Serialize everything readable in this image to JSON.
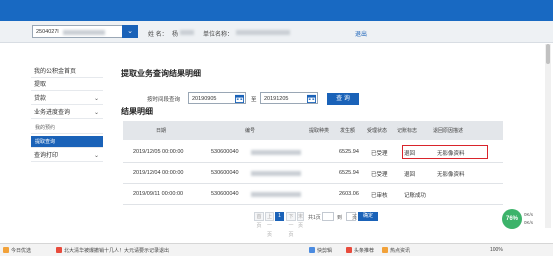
{
  "header": {
    "account_value": "2504027l",
    "name_label": "姓 名：",
    "name_value": "杨",
    "unit_label": "单位名称：",
    "exit_link": "退出"
  },
  "sidebar": {
    "items": [
      {
        "label": "我的公积金首页",
        "chevron": ""
      },
      {
        "label": "提取",
        "chevron": ""
      },
      {
        "label": "贷款",
        "chevron": "⌄"
      },
      {
        "label": "业务进度查询",
        "chevron": "⌄"
      },
      {
        "label": "我的预约",
        "chevron": ""
      },
      {
        "label": "提取查询",
        "chevron": ""
      },
      {
        "label": "查询打印",
        "chevron": "⌄"
      }
    ]
  },
  "main": {
    "page_title": "提取业务查询结果明细",
    "filter_label": "按时间段查询",
    "date_from": "20190905",
    "to_label": "至",
    "date_to": "20191205",
    "query_button": "查 询",
    "section_title": "结果明细"
  },
  "table": {
    "columns": [
      "日期",
      "编号",
      "提取种类",
      "发生额",
      "受理状态",
      "记账标志",
      "退回原因描述"
    ],
    "rows": [
      {
        "date": "2019/12/05 00:00:00",
        "id": "530600040",
        "type": "",
        "amount": "6525.94",
        "status": "已受理",
        "flag": "退回",
        "reason": "无影像资料"
      },
      {
        "date": "2019/12/04 00:00:00",
        "id": "530600040",
        "type": "",
        "amount": "6525.94",
        "status": "已受理",
        "flag": "退回",
        "reason": "无影像资料"
      },
      {
        "date": "2019/09/11 00:00:00",
        "id": "530600040",
        "type": "",
        "amount": "2603.06",
        "status": "已审核",
        "flag": "记账成功",
        "reason": ""
      }
    ]
  },
  "pager": {
    "first": "首页",
    "prev": "上一页",
    "current": "1",
    "next": "下一页",
    "last": "末页",
    "total_label": "共1页",
    "goto_label": "到",
    "page_unit": "页",
    "go_button": "确定"
  },
  "status_bar": {
    "favorites": "今日优选",
    "news": "北大清华被爆撤销十几人！大元请要示记录退出",
    "items": [
      "快剪辑",
      "头条推荐",
      "热点资讯"
    ],
    "zoom": "100%"
  },
  "speed": {
    "percent": "76%",
    "up": "0K/s",
    "down": "0K/s"
  },
  "colors": {
    "brand_blue": "#1869c2",
    "highlight_red": "#d9242b"
  }
}
